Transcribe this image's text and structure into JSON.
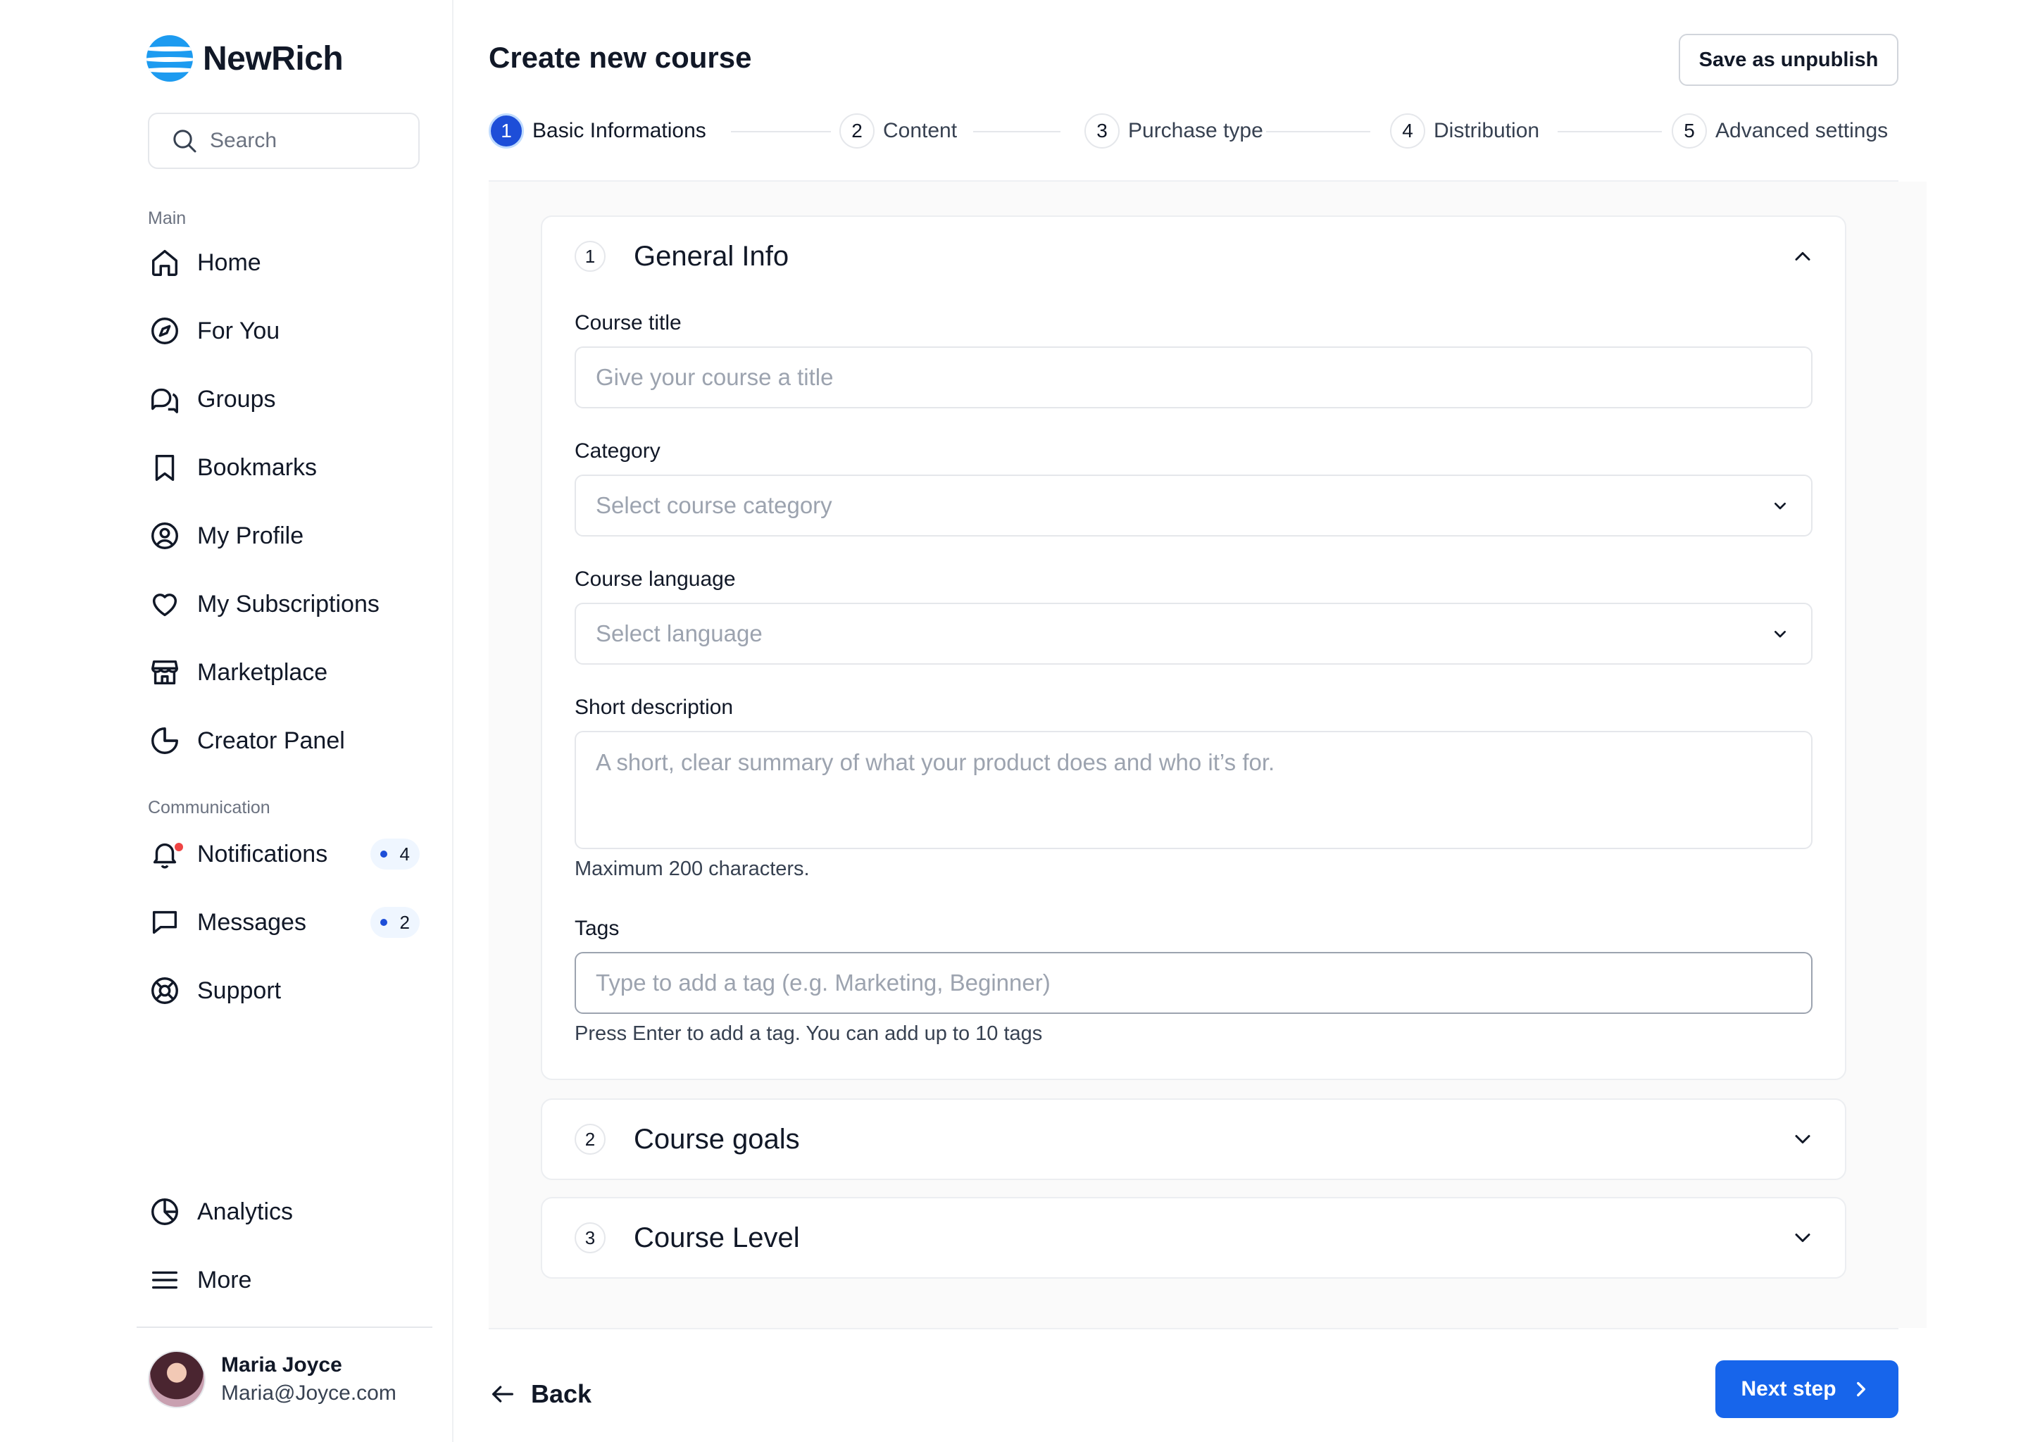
{
  "app": {
    "name": "NewRich"
  },
  "sidebar": {
    "search_placeholder": "Search",
    "section_main": "Main",
    "main_items": [
      {
        "label": "Home",
        "icon": "home-icon"
      },
      {
        "label": "For You",
        "icon": "compass-icon"
      },
      {
        "label": "Groups",
        "icon": "chat-bubbles-icon"
      },
      {
        "label": "Bookmarks",
        "icon": "bookmark-icon"
      },
      {
        "label": "My Profile",
        "icon": "user-circle-icon"
      },
      {
        "label": "My Subscriptions",
        "icon": "heart-icon"
      },
      {
        "label": "Marketplace",
        "icon": "store-icon"
      },
      {
        "label": "Creator Panel",
        "icon": "pie-chart-icon"
      }
    ],
    "section_communication": "Communication",
    "comm_items": [
      {
        "label": "Notifications",
        "icon": "bell-icon",
        "badge": "4"
      },
      {
        "label": "Messages",
        "icon": "message-icon",
        "badge": "2"
      },
      {
        "label": "Support",
        "icon": "lifebuoy-icon"
      }
    ],
    "bottom_items": [
      {
        "label": "Analytics",
        "icon": "analytics-icon"
      },
      {
        "label": "More",
        "icon": "menu-icon"
      }
    ],
    "user": {
      "name": "Maria Joyce",
      "email": "Maria@Joyce.com"
    }
  },
  "header": {
    "title": "Create new course",
    "save_button": "Save as unpublish"
  },
  "stepper": [
    {
      "num": "1",
      "label": "Basic Informations",
      "active": true
    },
    {
      "num": "2",
      "label": "Content"
    },
    {
      "num": "3",
      "label": "Purchase type"
    },
    {
      "num": "4",
      "label": "Distribution"
    },
    {
      "num": "5",
      "label": "Advanced settings"
    }
  ],
  "general_info": {
    "num": "1",
    "title": "General Info",
    "course_title_label": "Course title",
    "course_title_placeholder": "Give your course a title",
    "category_label": "Category",
    "category_placeholder": "Select course category",
    "language_label": "Course language",
    "language_placeholder": "Select language",
    "description_label": "Short description",
    "description_placeholder": "A short, clear summary of what your product does and who it’s for.",
    "description_hint": "Maximum 200 characters.",
    "tags_label": "Tags",
    "tags_placeholder": "Type to add a tag (e.g. Marketing, Beginner)",
    "tags_hint": "Press Enter to add a tag. You can add up to 10 tags"
  },
  "course_goals": {
    "num": "2",
    "title": "Course goals"
  },
  "course_level": {
    "num": "3",
    "title": "Course Level"
  },
  "footer": {
    "back": "Back",
    "next": "Next step"
  },
  "colors": {
    "accent": "#1765eb",
    "step_active": "#1d4ed8",
    "notif_dot": "#ef4444",
    "logo": "#1d9bf0"
  }
}
